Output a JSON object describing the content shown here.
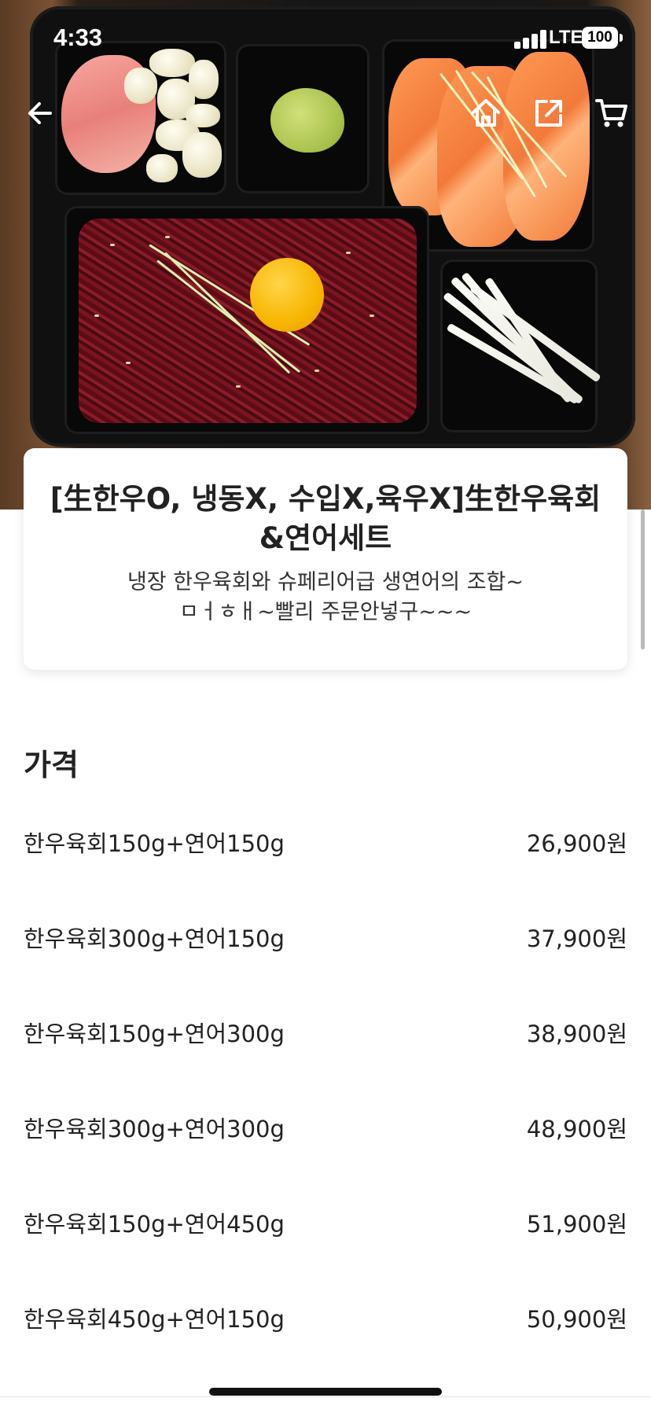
{
  "status_bar": {
    "time": "4:33",
    "network": "LTE",
    "battery": "100"
  },
  "nav": {
    "back_icon": "arrow-left-icon",
    "home_icon": "home-icon",
    "share_icon": "share-icon",
    "cart_icon": "cart-icon"
  },
  "product": {
    "title_line1": "[生한우O, 냉동X, 수입X,육우X]生한우육회",
    "title_line2": "&연어세트",
    "desc_line1": "냉장 한우육회와 슈페리어급 생연어의 조합~",
    "desc_line2": "ㅁㅓㅎㅐ~빨리 주문안넣구~~~"
  },
  "price_section": {
    "title": "가격",
    "options": [
      {
        "name": "한우육회150g+연어150g",
        "price": "26,900원"
      },
      {
        "name": "한우육회300g+연어150g",
        "price": "37,900원"
      },
      {
        "name": "한우육회150g+연어300g",
        "price": "38,900원"
      },
      {
        "name": "한우육회300g+연어300g",
        "price": "48,900원"
      },
      {
        "name": "한우육회150g+연어450g",
        "price": "51,900원"
      },
      {
        "name": "한우육회450g+연어150g",
        "price": "50,900원"
      }
    ]
  },
  "colors": {
    "accent_text": "#222222",
    "background": "#ffffff"
  }
}
